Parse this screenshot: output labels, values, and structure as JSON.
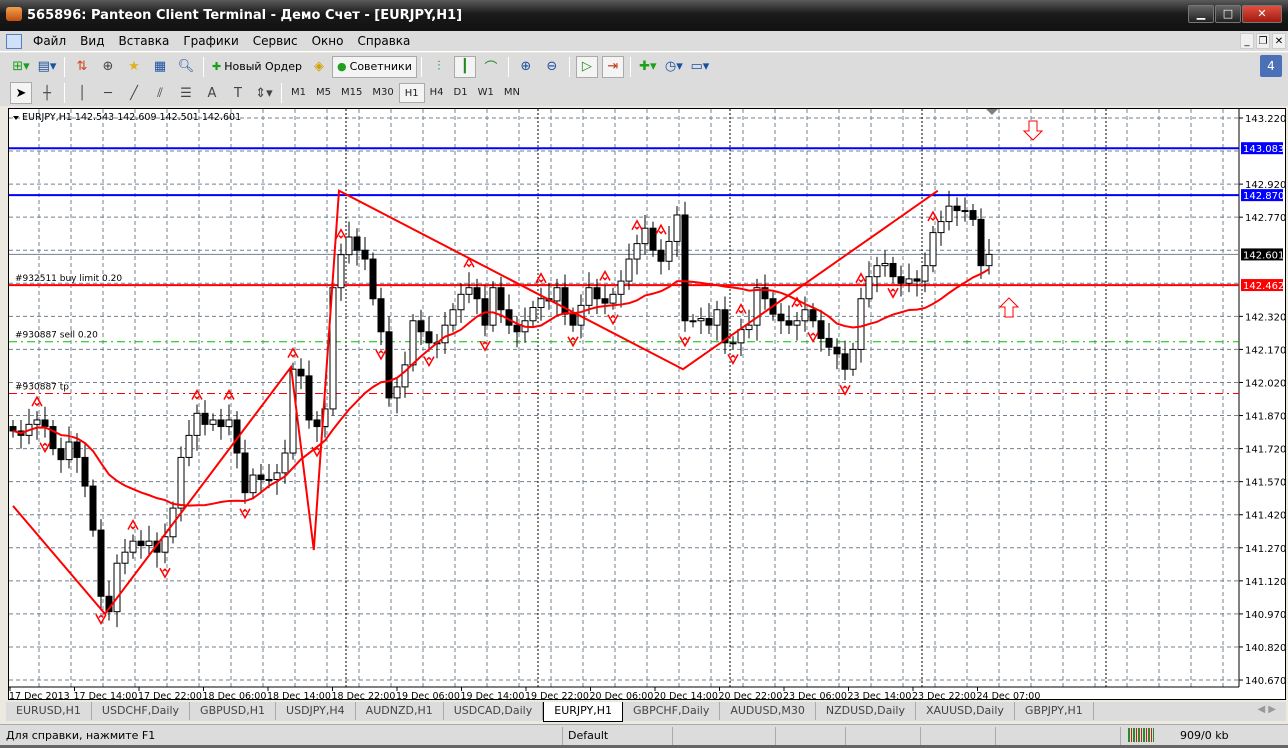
{
  "window": {
    "title": "565896: Panteon Client Terminal - Демо Счет - [EURJPY,H1]",
    "controls": [
      "minimize",
      "maximize",
      "close"
    ]
  },
  "menu": [
    "Файл",
    "Вид",
    "Вставка",
    "Графики",
    "Сервис",
    "Окно",
    "Справка"
  ],
  "toolbar": {
    "new_order": "Новый Ордер",
    "experts": "Советники",
    "notifications": "4"
  },
  "timeframes": [
    "M1",
    "M5",
    "M15",
    "M30",
    "H1",
    "H4",
    "D1",
    "W1",
    "MN"
  ],
  "active_timeframe": "H1",
  "chart": {
    "info": "EURJPY,H1  142.543 142.609 142.501 142.601",
    "orders": {
      "buy_limit": "#932511 buy limit 0.20",
      "sell": "#930887 sell 0.20",
      "tp": "#930887 tp"
    },
    "colors": {
      "bull": "#ffffff",
      "bear": "#000000",
      "ma": "#ff0000",
      "zigzag": "#ff0000",
      "level": "#0000ff",
      "sell": "#00c000",
      "grid": "#708090"
    }
  },
  "chart_data": {
    "type": "candlestick",
    "symbol": "EURJPY",
    "timeframe": "H1",
    "ylim": [
      140.67,
      143.22
    ],
    "y_ticks": [
      "143.220",
      "142.920",
      "142.770",
      "142.320",
      "142.170",
      "142.020",
      "141.870",
      "141.720",
      "141.570",
      "141.420",
      "141.270",
      "141.120",
      "140.970",
      "140.820",
      "140.670"
    ],
    "x_ticks": [
      "17 Dec 2013",
      "17 Dec 14:00",
      "17 Dec 22:00",
      "18 Dec 06:00",
      "18 Dec 14:00",
      "18 Dec 22:00",
      "19 Dec 06:00",
      "19 Dec 14:00",
      "19 Dec 22:00",
      "20 Dec 06:00",
      "20 Dec 14:00",
      "20 Dec 22:00",
      "23 Dec 06:00",
      "23 Dec 14:00",
      "23 Dec 22:00",
      "24 Dec 07:00"
    ],
    "close": [
      141.8,
      141.78,
      141.83,
      141.85,
      141.82,
      141.72,
      141.67,
      141.75,
      141.68,
      141.55,
      141.35,
      141.05,
      140.98,
      141.2,
      141.25,
      141.3,
      141.28,
      141.3,
      141.25,
      141.32,
      141.45,
      141.68,
      141.78,
      141.88,
      141.83,
      141.85,
      141.82,
      141.85,
      141.7,
      141.52,
      141.6,
      141.58,
      141.58,
      141.61,
      141.7,
      142.08,
      142.05,
      141.85,
      141.82,
      141.9,
      142.45,
      142.6,
      142.68,
      142.62,
      142.58,
      142.4,
      142.25,
      141.95,
      142.0,
      142.1,
      142.3,
      142.25,
      142.2,
      142.2,
      142.28,
      142.35,
      142.42,
      142.45,
      142.4,
      142.28,
      142.45,
      142.35,
      142.28,
      142.25,
      142.3,
      142.36,
      142.4,
      142.39,
      142.45,
      142.33,
      142.28,
      142.37,
      142.45,
      142.4,
      142.38,
      142.42,
      142.48,
      142.58,
      142.65,
      142.72,
      142.62,
      142.57,
      142.66,
      142.78,
      142.3,
      142.3,
      142.31,
      142.28,
      142.35,
      142.2,
      142.2,
      142.26,
      142.28,
      142.45,
      142.4,
      142.33,
      142.3,
      142.28,
      142.3,
      142.35,
      142.3,
      142.22,
      142.18,
      142.15,
      142.08,
      142.17,
      142.4,
      142.5,
      142.55,
      142.56,
      142.5,
      142.47,
      142.49,
      142.48,
      142.55,
      142.7,
      142.75,
      142.82,
      142.8,
      142.8,
      142.76,
      142.55,
      142.601
    ],
    "zigzag": [
      [
        0,
        141.46
      ],
      [
        11.5,
        140.97
      ],
      [
        34.75,
        142.09
      ],
      [
        37.6,
        141.26
      ],
      [
        40.75,
        142.89
      ],
      [
        83.75,
        142.08
      ],
      [
        115.6,
        142.89
      ]
    ],
    "fractals_up": [
      3,
      15,
      23,
      27,
      35,
      41,
      57,
      66,
      74,
      78,
      81,
      91,
      98,
      106,
      115
    ],
    "fractals_down": [
      4,
      11,
      19,
      29,
      38,
      46,
      52,
      59,
      70,
      75,
      84,
      90,
      100,
      104,
      110
    ],
    "levels": [
      {
        "price": 143.083,
        "label": "143.083",
        "color": "#0000ff"
      },
      {
        "price": 142.87,
        "label": "142.870",
        "color": "#0000ff"
      },
      {
        "price": 142.601,
        "label": "142.601",
        "color": "#000000"
      },
      {
        "price": 142.462,
        "label": "142.462",
        "color": "#ff0000"
      }
    ],
    "order_lines": {
      "buy_limit": 142.462,
      "sell": 142.205,
      "tp": 141.97
    },
    "signal_arrows": [
      {
        "dir": "down",
        "index": 127
      },
      {
        "dir": "up",
        "index": 124
      }
    ]
  },
  "tabs": [
    "EURUSD,H1",
    "USDCHF,Daily",
    "GBPUSD,H1",
    "USDJPY,H4",
    "AUDNZD,H1",
    "USDCAD,Daily",
    "EURJPY,H1",
    "GBPCHF,Daily",
    "AUDUSD,M30",
    "NZDUSD,Daily",
    "XAUUSD,Daily",
    "GBPJPY,H1"
  ],
  "active_tab": "EURJPY,H1",
  "status": {
    "help": "Для справки, нажмите F1",
    "profile": "Default",
    "traffic": "909/0 kb"
  }
}
